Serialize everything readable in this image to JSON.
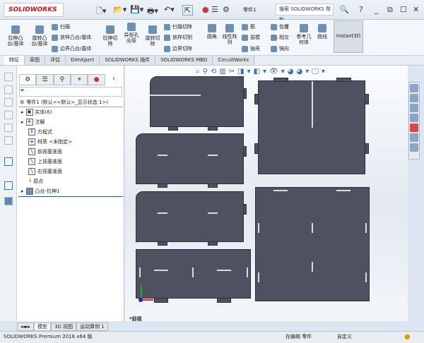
{
  "app": {
    "logo": "SOLIDWORKS",
    "doc": "零件1",
    "search_placeholder": "搜索 SOLIDWORKS 帮助",
    "help": "?"
  },
  "ribbon": {
    "big": [
      "拉伸凸台/基体",
      "旋转凸台/基体",
      "拉伸切除",
      "异型孔向导",
      "旋转切除",
      "圆角",
      "线性阵列",
      "参考几何体",
      "曲线"
    ],
    "small": [
      "扫描",
      "放样凸台/基体",
      "边界凸台/基体",
      "扫描切除",
      "放样切割",
      "边界切除",
      "筋",
      "拔模",
      "抽壳",
      "包覆",
      "相交",
      "镜向"
    ],
    "instant3d": "Instant3D"
  },
  "tabs": [
    {
      "label": "特征",
      "active": true
    },
    {
      "label": "草图"
    },
    {
      "label": "评估"
    },
    {
      "label": "DimXpert"
    },
    {
      "label": "SOLIDWORKS 插件"
    },
    {
      "label": "SOLIDWORKS MBD"
    },
    {
      "label": "CircuitWorks"
    }
  ],
  "tree": {
    "root": "零件1  (默认<<默认>_显示状态 1>)",
    "items": [
      "实体(6)",
      "注解",
      "方程式",
      "材质 <未指定>",
      "前视基准面",
      "上视基准面",
      "右视基准面",
      "原点",
      "凸台-拉伸1"
    ]
  },
  "canvas": {
    "view_label": "*前视"
  },
  "bottom_tabs": [
    "模型",
    "3D 视图",
    "运动算例 1"
  ],
  "status": {
    "product": "SOLIDWORKS Premium 2016 x64 版",
    "mode": "在编辑 零件",
    "units": "自定义"
  }
}
